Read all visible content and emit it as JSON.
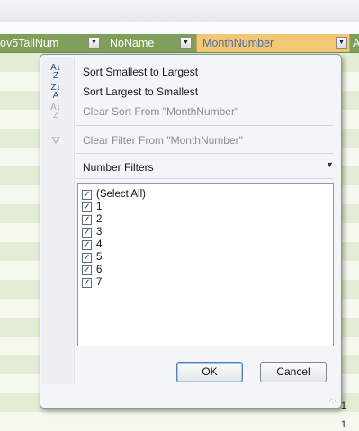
{
  "headers": {
    "col1": "ov5TailNum",
    "col2": "NoName",
    "col3": "MonthNumber",
    "col4": "A"
  },
  "grid": {
    "row_values": [
      "1",
      "1"
    ]
  },
  "menu": {
    "sort_asc": "Sort Smallest to Largest",
    "sort_desc": "Sort Largest to Smallest",
    "clear_sort": "Clear Sort From \"MonthNumber\"",
    "clear_filter": "Clear Filter From \"MonthNumber\"",
    "number_filters": "Number Filters"
  },
  "filter_list": [
    {
      "label": "(Select All)",
      "checked": true
    },
    {
      "label": "1",
      "checked": true
    },
    {
      "label": "2",
      "checked": true
    },
    {
      "label": "3",
      "checked": true
    },
    {
      "label": "4",
      "checked": true
    },
    {
      "label": "5",
      "checked": true
    },
    {
      "label": "6",
      "checked": true
    },
    {
      "label": "7",
      "checked": true
    }
  ],
  "buttons": {
    "ok": "OK",
    "cancel": "Cancel"
  },
  "icons": {
    "sort_asc": "sort-ascending-icon",
    "sort_desc": "sort-descending-icon",
    "clear_sort": "clear-sort-icon",
    "clear_filter": "clear-filter-icon",
    "dropdown": "dropdown-arrow-icon",
    "check": "checkmark-icon"
  },
  "colors": {
    "header_bg": "#7fa05a",
    "active_header_bg": "#f4c774",
    "row_odd": "#e3edd3",
    "row_even": "#f4f8ee"
  }
}
